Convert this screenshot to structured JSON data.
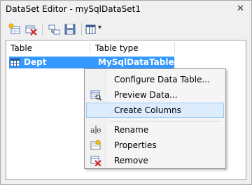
{
  "window": {
    "title": "DataSet Editor - mySqlDataSet1",
    "close_glyph": "✕"
  },
  "toolbar": {
    "buttons": [
      {
        "icon": "add-table-icon"
      },
      {
        "icon": "delete-icon"
      },
      {
        "icon": "relation-icon"
      },
      {
        "icon": "save-icon"
      },
      {
        "icon": "columns-view-icon"
      }
    ],
    "dropdown_glyph": "▾"
  },
  "grid": {
    "columns": [
      "Table",
      "Table type"
    ],
    "rows": [
      {
        "table": "Dept",
        "type": "MySqlDataTable",
        "selected": true
      }
    ]
  },
  "context_menu": {
    "items": [
      {
        "label": "Configure Data Table...",
        "icon": "",
        "highlighted": false
      },
      {
        "label": "Preview Data...",
        "icon": "preview-data-icon",
        "highlighted": false
      },
      {
        "label": "Create Columns",
        "icon": "",
        "highlighted": true
      },
      {
        "label": "Rename",
        "icon": "rename-icon",
        "highlighted": false
      },
      {
        "label": "Properties",
        "icon": "properties-icon",
        "highlighted": false
      },
      {
        "label": "Remove",
        "icon": "remove-icon",
        "highlighted": false
      }
    ]
  },
  "colors": {
    "selection": "#3399ff",
    "menu_highlight": "#dcecfc",
    "menu_highlight_border": "#99c9ef"
  }
}
